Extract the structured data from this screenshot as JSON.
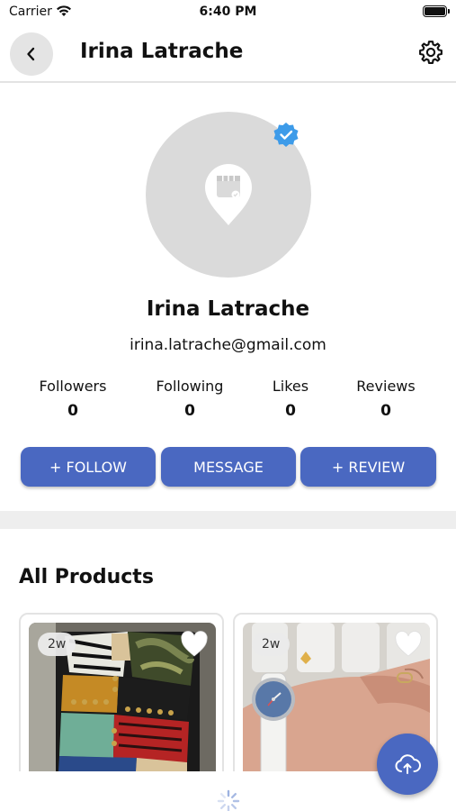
{
  "status_bar": {
    "carrier": "Carrier",
    "time": "6:40 PM"
  },
  "header": {
    "title": "Irina Latrache",
    "back_icon": "chevron-left-icon",
    "settings_icon": "gear-icon"
  },
  "profile": {
    "name": "Irina Latrache",
    "email": "irina.latrache@gmail.com",
    "avatar_icon": "location-pin-placeholder-icon",
    "verified_icon": "verified-badge-icon"
  },
  "stats": [
    {
      "label": "Followers",
      "value": "0"
    },
    {
      "label": "Following",
      "value": "0"
    },
    {
      "label": "Likes",
      "value": "0"
    },
    {
      "label": "Reviews",
      "value": "0"
    }
  ],
  "actions": {
    "follow": "+ FOLLOW",
    "message": "MESSAGE",
    "review": "+ REVIEW"
  },
  "products_section": {
    "title": "All Products"
  },
  "products": [
    {
      "age": "2w",
      "image": "patchwork-studded-backpack",
      "favorite_icon": "heart-icon"
    },
    {
      "age": "2w",
      "image": "wristwatch-on-hand",
      "favorite_icon": "heart-icon"
    }
  ],
  "fab": {
    "icon": "cloud-upload-icon"
  },
  "colors": {
    "primary": "#4a68c1",
    "verified": "#3d9be9",
    "avatar_bg": "#dadada",
    "divider": "#eeeeee"
  }
}
